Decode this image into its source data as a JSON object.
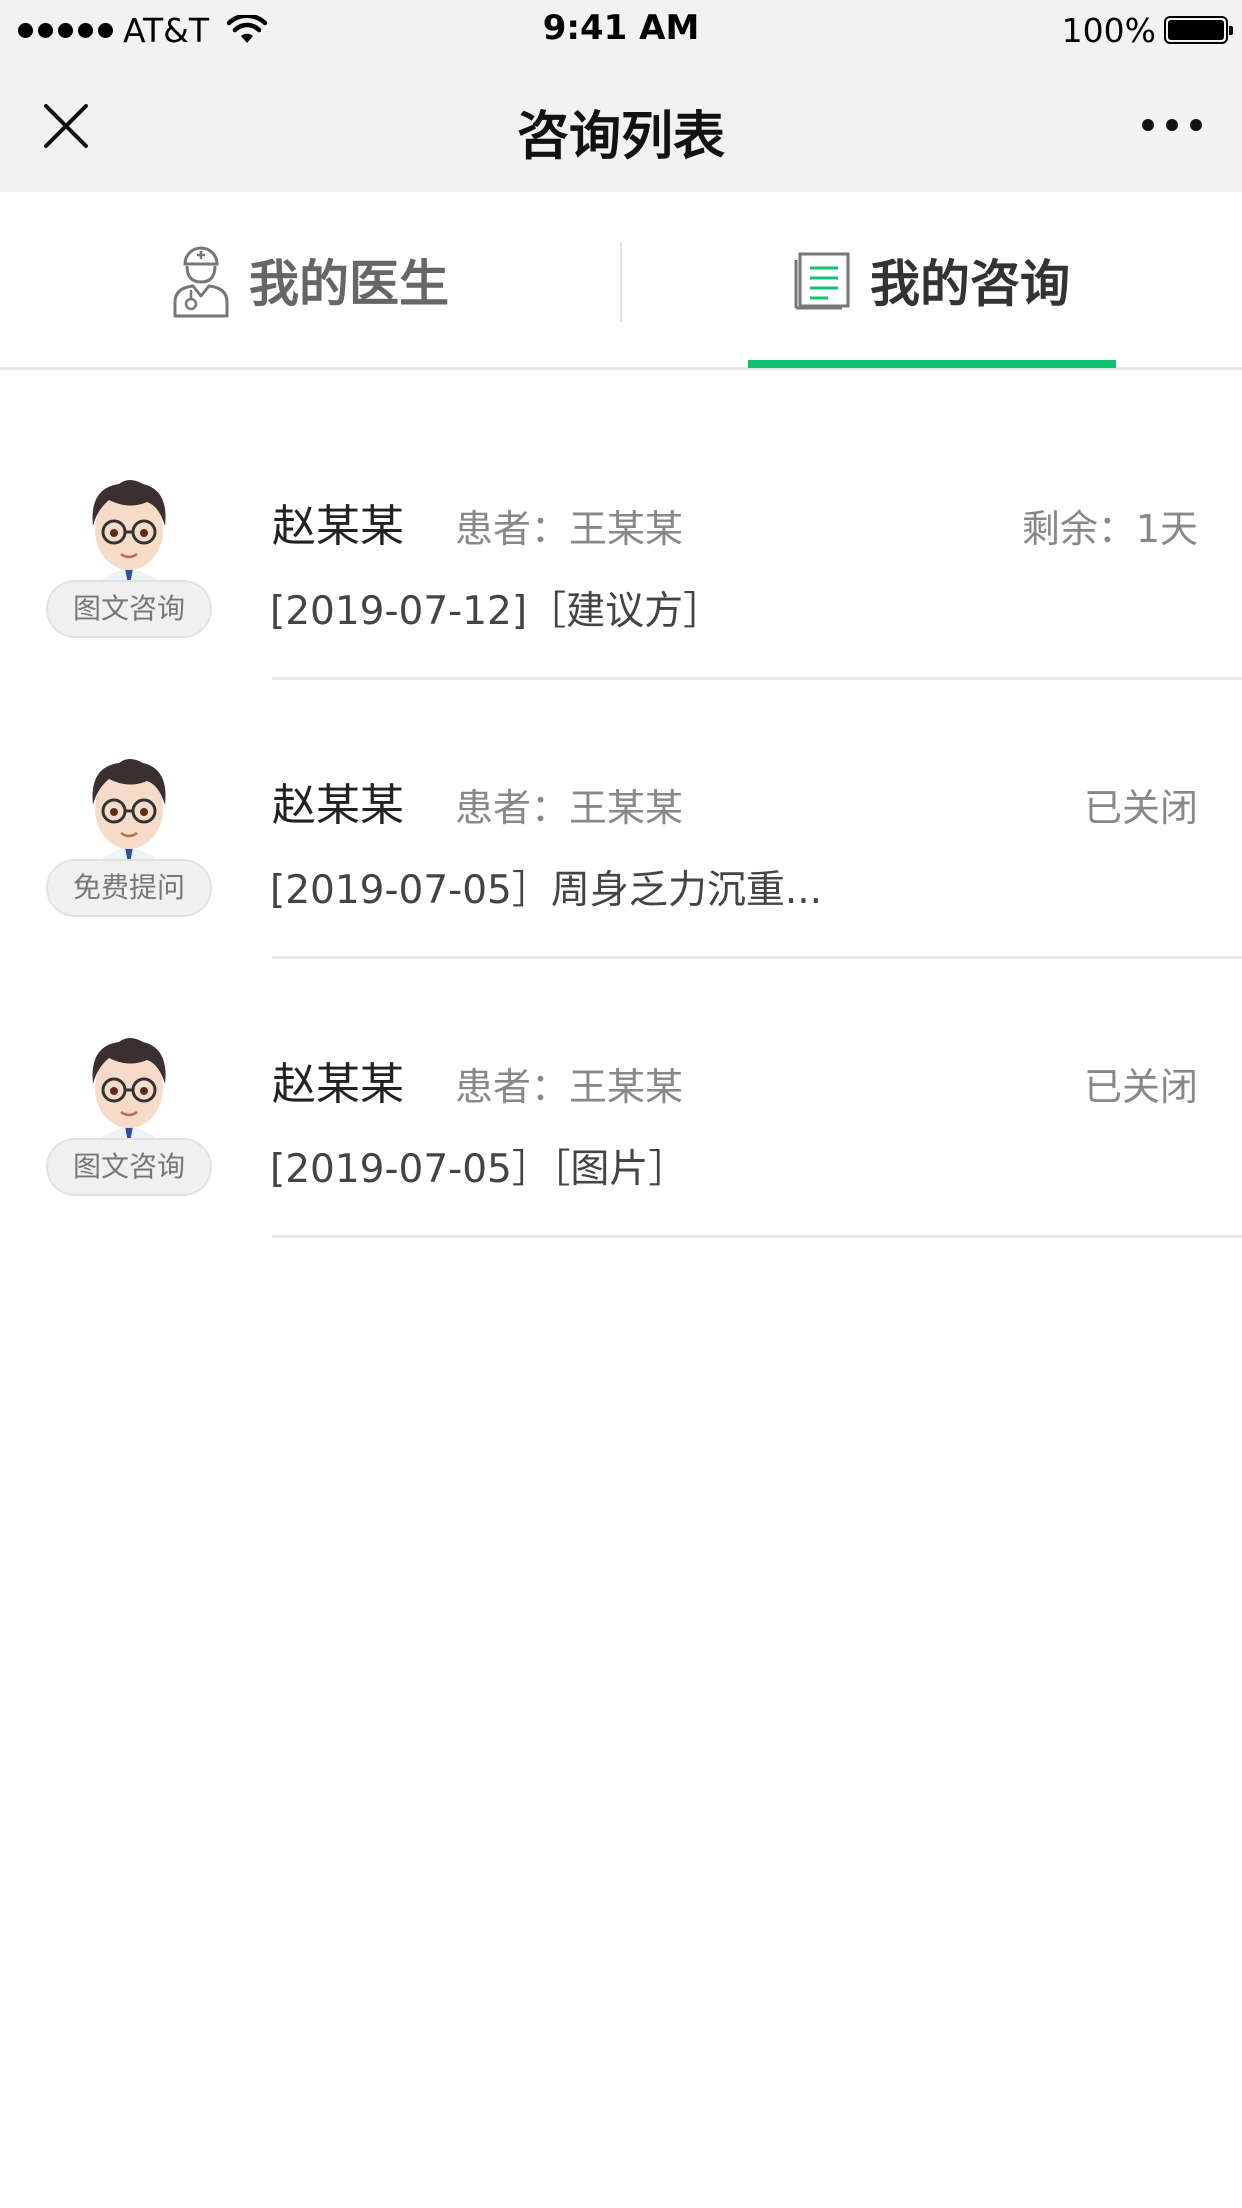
{
  "status_bar": {
    "carrier": "AT&T",
    "time": "9:41 AM",
    "battery": "100%"
  },
  "nav": {
    "title": "咨询列表"
  },
  "tabs": [
    {
      "label": "我的医生",
      "active": false,
      "icon": "doctor-icon"
    },
    {
      "label": "我的咨询",
      "active": true,
      "icon": "list-document-icon"
    }
  ],
  "accent_color": "#11c16f",
  "consultations": [
    {
      "doctor": "赵某某",
      "patient": "患者：王某某",
      "status": "剩余：1天",
      "tag": "图文咨询",
      "summary": "[2019-07-12]［建议方］"
    },
    {
      "doctor": "赵某某",
      "patient": "患者：王某某",
      "status": "已关闭",
      "tag": "免费提问",
      "summary": "[2019-07-05］周身乏力沉重..."
    },
    {
      "doctor": "赵某某",
      "patient": "患者：王某某",
      "status": "已关闭",
      "tag": "图文咨询",
      "summary": "[2019-07-05］［图片］"
    }
  ]
}
